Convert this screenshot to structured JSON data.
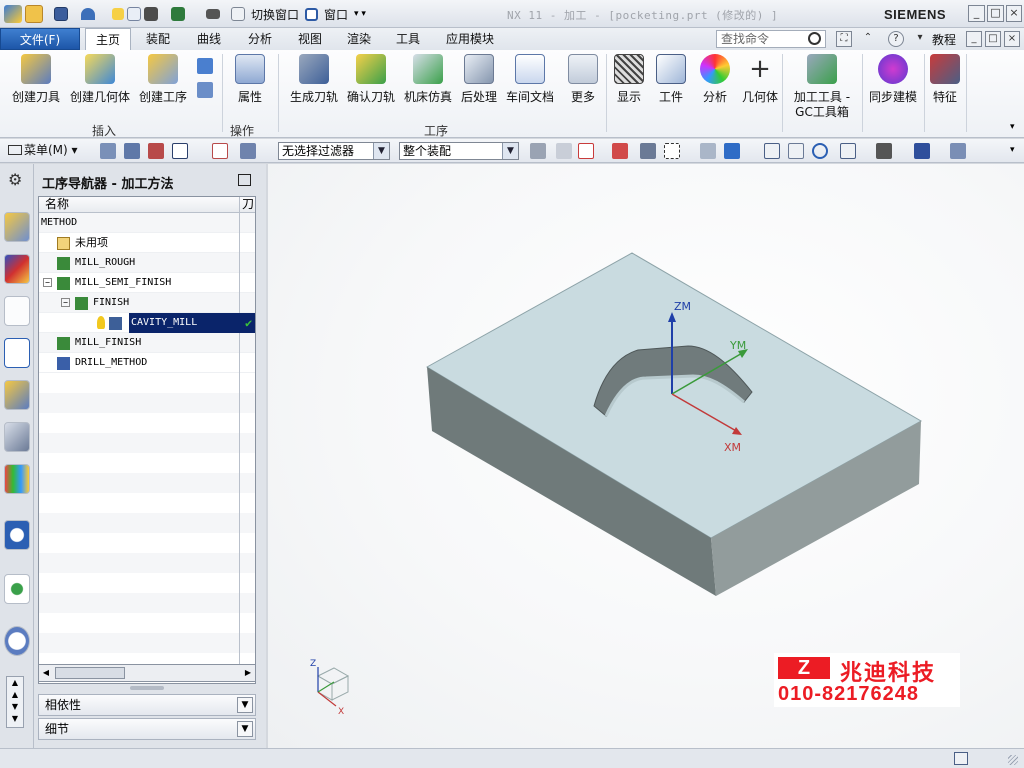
{
  "titlebar": {
    "switch_window": "切换窗口",
    "window_menu": "窗口",
    "title": "NX 11 - 加工 - [pocketing.prt  (修改的) ]",
    "brand": "SIEMENS"
  },
  "tabs": {
    "file": "文件(F)",
    "items": [
      "主页",
      "装配",
      "曲线",
      "分析",
      "视图",
      "渲染",
      "工具",
      "应用模块"
    ],
    "active": "主页",
    "search_placeholder": "查找命令",
    "tutorial": "教程"
  },
  "ribbon": {
    "buttons": {
      "create_tool": "创建刀具",
      "create_geometry": "创建几何体",
      "create_operation": "创建工序",
      "properties": "属性",
      "generate_path": "生成刀轨",
      "verify_path": "确认刀轨",
      "machine_sim": "机床仿真",
      "postprocess": "后处理",
      "shop_doc": "车间文档",
      "more": "更多",
      "display": "显示",
      "workpiece": "工件",
      "analysis": "分析",
      "geometry": "几何体",
      "machining_tools": "加工工具 -",
      "gc_toolbox": "GC工具箱",
      "sync_modeling": "同步建模",
      "feature": "特征"
    },
    "groups": {
      "insert": "插入",
      "operation": "操作",
      "process": "工序"
    }
  },
  "toolbar": {
    "menu": "菜单(M)",
    "filter_value": "无选择过滤器",
    "assembly_value": "整个装配"
  },
  "navigator": {
    "title": "工序导航器 - 加工方法",
    "column_name": "名称",
    "column_2": "刀",
    "rows": [
      {
        "label": "METHOD",
        "indent": 0
      },
      {
        "label": "未用项",
        "indent": 1
      },
      {
        "label": "MILL_ROUGH",
        "indent": 1
      },
      {
        "label": "MILL_SEMI_FINISH",
        "indent": 1
      },
      {
        "label": "FINISH",
        "indent": 2
      },
      {
        "label": "CAVITY_MILL",
        "indent": 3
      },
      {
        "label": "MILL_FINISH",
        "indent": 1
      },
      {
        "label": "DRILL_METHOD",
        "indent": 1
      }
    ],
    "dependencies": "相依性",
    "details": "细节"
  },
  "viewport": {
    "axis_zm": "ZM",
    "axis_ym": "YM",
    "axis_xm": "XM",
    "triad_z": "Z",
    "triad_x": "X"
  },
  "watermark": {
    "mark": "Z",
    "company": "兆迪科技",
    "phone": "010-82176248"
  },
  "colors": {
    "accent": "#1d56a8",
    "selection": "#0a246a",
    "part_top": "#c9dbe0",
    "part_side_left": "#6f7a7a",
    "part_side_right": "#929c9c",
    "watermark": "#ec1c24"
  }
}
